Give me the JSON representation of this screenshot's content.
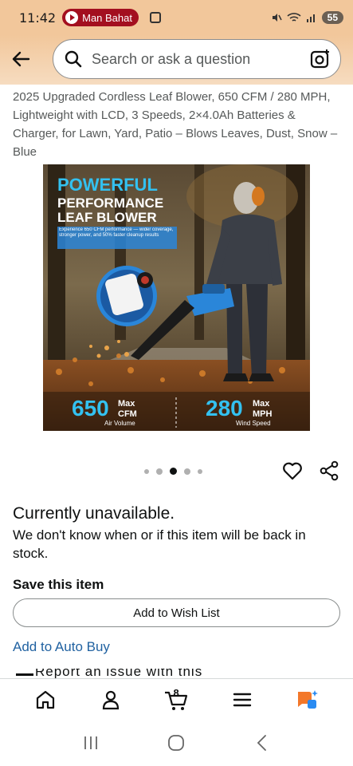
{
  "status_bar": {
    "time": "11:42",
    "recording_label": "Man Bahat",
    "battery": "55"
  },
  "search": {
    "placeholder": "Search or ask a question"
  },
  "product": {
    "title": "2025 Upgraded Cordless Leaf Blower, 650 CFM / 280 MPH, Lightweight with LCD, 3 Speeds, 2×4.0Ah Batteries & Charger, for Lawn, Yard, Patio – Blows Leaves, Dust, Snow – Blue",
    "image": {
      "headline_1": "POWERFUL",
      "headline_2": "PERFORMANCE",
      "headline_3": "LEAF BLOWER",
      "blurb": "Experience 650 CFM performance — wider coverage, stronger power, and 50% faster cleanup results",
      "stat1_value": "650",
      "stat1_unit_top": "Max",
      "stat1_unit_bottom": "CFM",
      "stat1_caption": "Air Volume",
      "stat2_value": "280",
      "stat2_unit_top": "Max",
      "stat2_unit_bottom": "MPH",
      "stat2_caption": "Wind Speed"
    },
    "carousel": {
      "count": 5,
      "active_index": 2
    }
  },
  "availability": {
    "heading": "Currently unavailable.",
    "description": "We don't know when or if this item will be back in stock."
  },
  "save": {
    "heading": "Save this item",
    "wish_list_label": "Add to Wish List"
  },
  "auto_buy_label": "Add to Auto Buy",
  "partial_row_text": "Report an issue with this product",
  "bottom_nav": {
    "cart_count": "8",
    "items": [
      "home-icon",
      "account-icon",
      "cart-icon",
      "menu-icon",
      "rufus-icon"
    ]
  },
  "colors": {
    "header_bg": "#f2c79b",
    "link": "#2162a1",
    "rufus_orange": "#f3782a",
    "rufus_blue": "#2a8bf2"
  }
}
